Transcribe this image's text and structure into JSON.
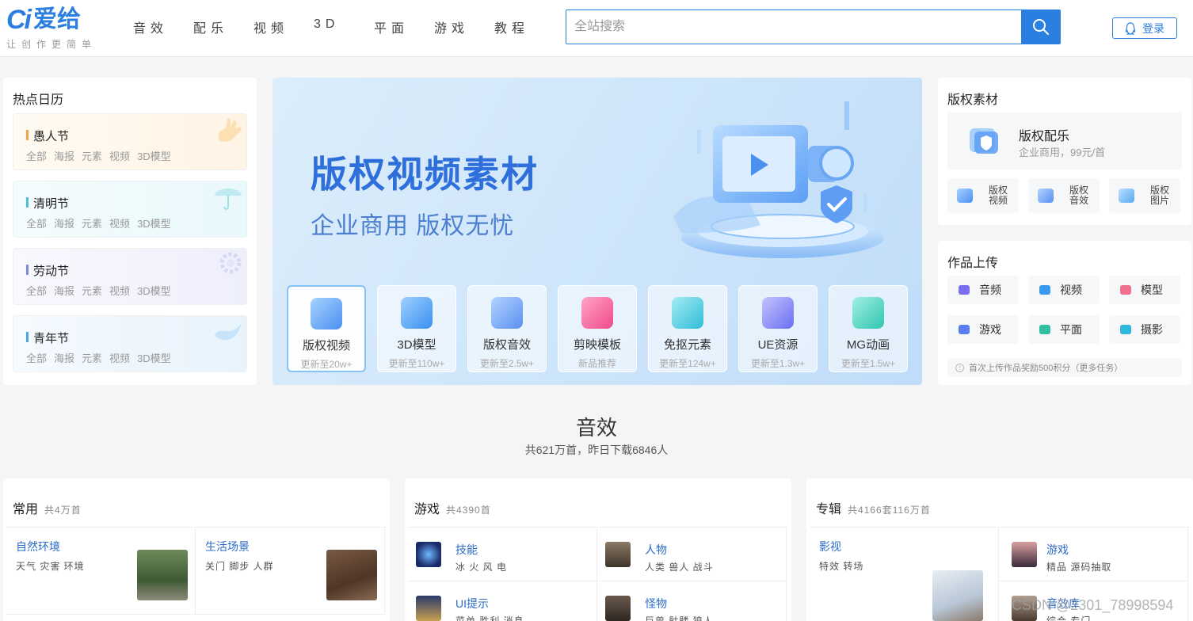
{
  "header": {
    "logo": {
      "mark": "Ci",
      "name": "爱给",
      "slogan": "让创作更简单"
    },
    "nav": [
      "音效",
      "配乐",
      "视频",
      "3D",
      "平面",
      "游戏",
      "教程"
    ],
    "search_placeholder": "全站搜索",
    "login": "登录"
  },
  "calendar": {
    "title": "热点日历",
    "items": [
      {
        "name": "愚人节",
        "tags": [
          "全部",
          "海报",
          "元素",
          "视频",
          "3D模型"
        ],
        "color": "#f5a04b"
      },
      {
        "name": "清明节",
        "tags": [
          "全部",
          "海报",
          "元素",
          "视频",
          "3D模型"
        ],
        "color": "#4cc0d8"
      },
      {
        "name": "劳动节",
        "tags": [
          "全部",
          "海报",
          "元素",
          "视频",
          "3D模型"
        ],
        "color": "#7b8bd9"
      },
      {
        "name": "青年节",
        "tags": [
          "全部",
          "海报",
          "元素",
          "视频",
          "3D模型"
        ],
        "color": "#4aa8e8"
      }
    ]
  },
  "banner": {
    "headline": "版权视频素材",
    "subline": "企业商用  版权无忧",
    "resources": [
      {
        "label": "版权视频",
        "meta": "更新至20w+",
        "color": "#4a90f0"
      },
      {
        "label": "3D模型",
        "meta": "更新至110w+",
        "color": "#3a8ff0"
      },
      {
        "label": "版权音效",
        "meta": "更新至2.5w+",
        "color": "#5a8ff0"
      },
      {
        "label": "剪映模板",
        "meta": "新品推荐",
        "color": "#f04a8a"
      },
      {
        "label": "免抠元素",
        "meta": "更新至124w+",
        "color": "#2fbcd6"
      },
      {
        "label": "UE资源",
        "meta": "更新至1.3w+",
        "color": "#6a6ef0"
      },
      {
        "label": "MG动画",
        "meta": "更新至1.5w+",
        "color": "#2fc5b0"
      }
    ]
  },
  "copyright": {
    "title": "版权素材",
    "main": {
      "title": "版权配乐",
      "subtitle": "企业商用，99元/首"
    },
    "subs": [
      "版权视频",
      "版权音效",
      "版权图片"
    ]
  },
  "upload": {
    "title": "作品上传",
    "items": [
      {
        "label": "音频",
        "color": "#7b6ef0"
      },
      {
        "label": "视频",
        "color": "#3a9af0"
      },
      {
        "label": "模型",
        "color": "#f07090"
      },
      {
        "label": "游戏",
        "color": "#5a7ef0"
      },
      {
        "label": "平面",
        "color": "#30c0a0"
      },
      {
        "label": "摄影",
        "color": "#2fb8d8"
      }
    ],
    "tip": "首次上传作品奖励500积分（更多任务）"
  },
  "section": {
    "title": "音效",
    "subtitle": "共621万首，昨日下载6846人"
  },
  "categories": [
    {
      "title": "常用",
      "count": "共4万首",
      "items": [
        {
          "title": "自然环境",
          "sub": "天气 灾害 环境"
        },
        {
          "title": "生活场景",
          "sub": "关门 脚步 人群"
        }
      ]
    },
    {
      "title": "游戏",
      "count": "共4390首",
      "items": [
        {
          "title": "技能",
          "sub": "冰 火 风 电"
        },
        {
          "title": "人物",
          "sub": "人类 兽人 战斗"
        },
        {
          "title": "UI提示",
          "sub": "菜单 胜利 消息"
        },
        {
          "title": "怪物",
          "sub": "巨兽 骷髅 狼人"
        }
      ]
    },
    {
      "title": "专辑",
      "count": "共4166套116万首",
      "items": [
        {
          "title": "影视",
          "sub": "特效 转场"
        },
        {
          "title": "游戏",
          "sub": "精品 源码抽取"
        },
        {
          "title": "音效库",
          "sub": "综合 专门"
        }
      ]
    }
  ],
  "watermark": "CSDN @2301_78998594",
  "colors": {
    "brand": "#2b7fe0",
    "banner_text": "#2e6fdc",
    "link": "#2b6bc8"
  }
}
